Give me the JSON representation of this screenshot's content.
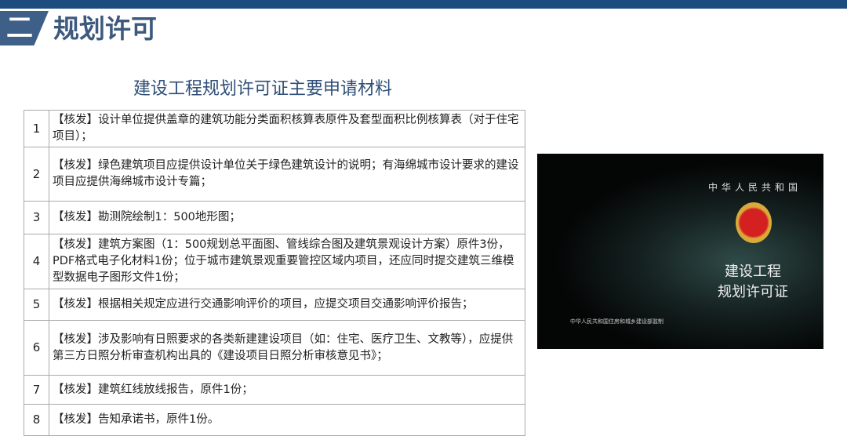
{
  "header": {
    "section_number": "二",
    "section_title": "规划许可"
  },
  "doc_title": "建设工程规划许可证主要申请材料",
  "rows": [
    {
      "n": "1",
      "text": "【核发】设计单位提供盖章的建筑功能分类面积核算表原件及套型面积比例核算表（对于住宅项目）；"
    },
    {
      "n": "2",
      "text": "【核发】绿色建筑项目应提供设计单位关于绿色建筑设计的说明；有海绵城市设计要求的建设项目应提供海绵城市设计专篇；"
    },
    {
      "n": "3",
      "text": "【核发】勘测院绘制1：500地形图；"
    },
    {
      "n": "4",
      "text": "【核发】建筑方案图（1：500规划总平面图、管线综合图及建筑景观设计方案）原件3份，PDF格式电子化材料1份；位于城市建筑景观重要管控区域内项目，还应同时提交建筑三维模型数据电子图形文件1份；"
    },
    {
      "n": "5",
      "text": "【核发】根据相关规定应进行交通影响评价的项目，应提交项目交通影响评价报告；"
    },
    {
      "n": "6",
      "text": "【核发】涉及影响有日照要求的各类新建建设项目（如：住宅、医疗卫生、文教等），应提供第三方日照分析审查机构出具的《建设项目日照分析审核意见书》；"
    },
    {
      "n": "7",
      "text": "【核发】建筑红线放线报告，原件1份；"
    },
    {
      "n": "8",
      "text": "【核发】告知承诺书，原件1份。"
    }
  ],
  "photo": {
    "country": "中华人民共和国",
    "title_line1": "建设工程",
    "title_line2": "规划许可证",
    "issuer": "中华人民共和国住房和城乡建设部监制"
  }
}
